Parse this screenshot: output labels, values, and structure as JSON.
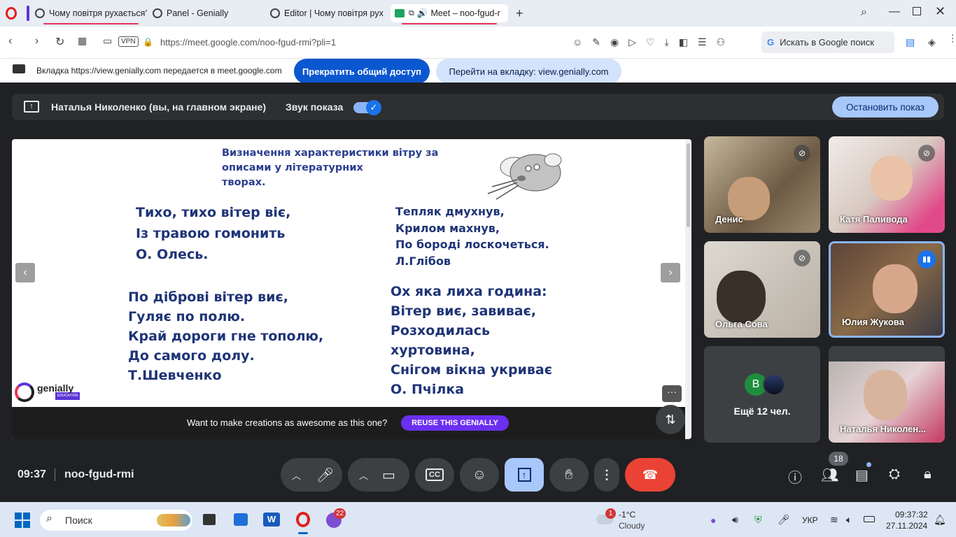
{
  "tabs": [
    {
      "title": "Чому повітря рухається?"
    },
    {
      "title": "Panel - Genially"
    },
    {
      "title": "Editor | Чому повітря рух"
    },
    {
      "title": "Meet – noo-fgud-r"
    }
  ],
  "address": {
    "url": "https://meet.google.com/noo-fgud-rmi?pli=1",
    "vpn": "VPN",
    "search": "Искать в Google поиск"
  },
  "share_bar": {
    "message": "Вкладка https://view.genially.com передается в meet.google.com",
    "stop_share": "Прекратить общий доступ",
    "go_tab": "Перейти на вкладку: view.genially.com"
  },
  "presenting": {
    "name": "Наталья Николенко (вы, на главном экране)",
    "sound_label": "Звук показа",
    "stop_label": "Остановить показ"
  },
  "slide": {
    "title": "Визначення характеристики вітру за\nописами у літературних\nтворах.",
    "poem1": "Тихо, тихо вітер віє,\nІз травою гомонить\nО. Олесь.",
    "poem2": "Тепляк дмухнув,\nКрилом махнув,\nПо бороді лоскочеться.\nЛ.Глібов",
    "poem3": "По діброві вітер виє,\nГуляє по полю.\nКрай дороги гне тополю,\nДо самого долу.\nТ.Шевченко",
    "poem4": "Ох яка лиха година:\nВітер виє, завиває,\nРозходилась\nхуртовина,\nСнігом вікна укриває\nО. Пчілка",
    "logo": "genially",
    "logo_sub": "EDUCATION",
    "promo": "Want to make creations as awesome as this one?",
    "reuse": "REUSE THIS GENIALLY"
  },
  "participants": [
    {
      "name": "Денис"
    },
    {
      "name": "Катя Паливода"
    },
    {
      "name": "Ольга Сова"
    },
    {
      "name": "Юлия Жукова"
    },
    {
      "name": "Ещё 12 чел.",
      "avatar": "В"
    },
    {
      "name": "Наталья Николен..."
    }
  ],
  "bottom": {
    "time": "09:37",
    "meeting_code": "noo-fgud-rmi",
    "people_count": "18"
  },
  "taskbar": {
    "search": "Поиск",
    "weather_temp": "-1°C",
    "weather_desc": "Cloudy",
    "weather_badge": "1",
    "viber_badge": "22",
    "lang": "УКР",
    "time": "09:37:32",
    "date": "27.11.2024"
  }
}
